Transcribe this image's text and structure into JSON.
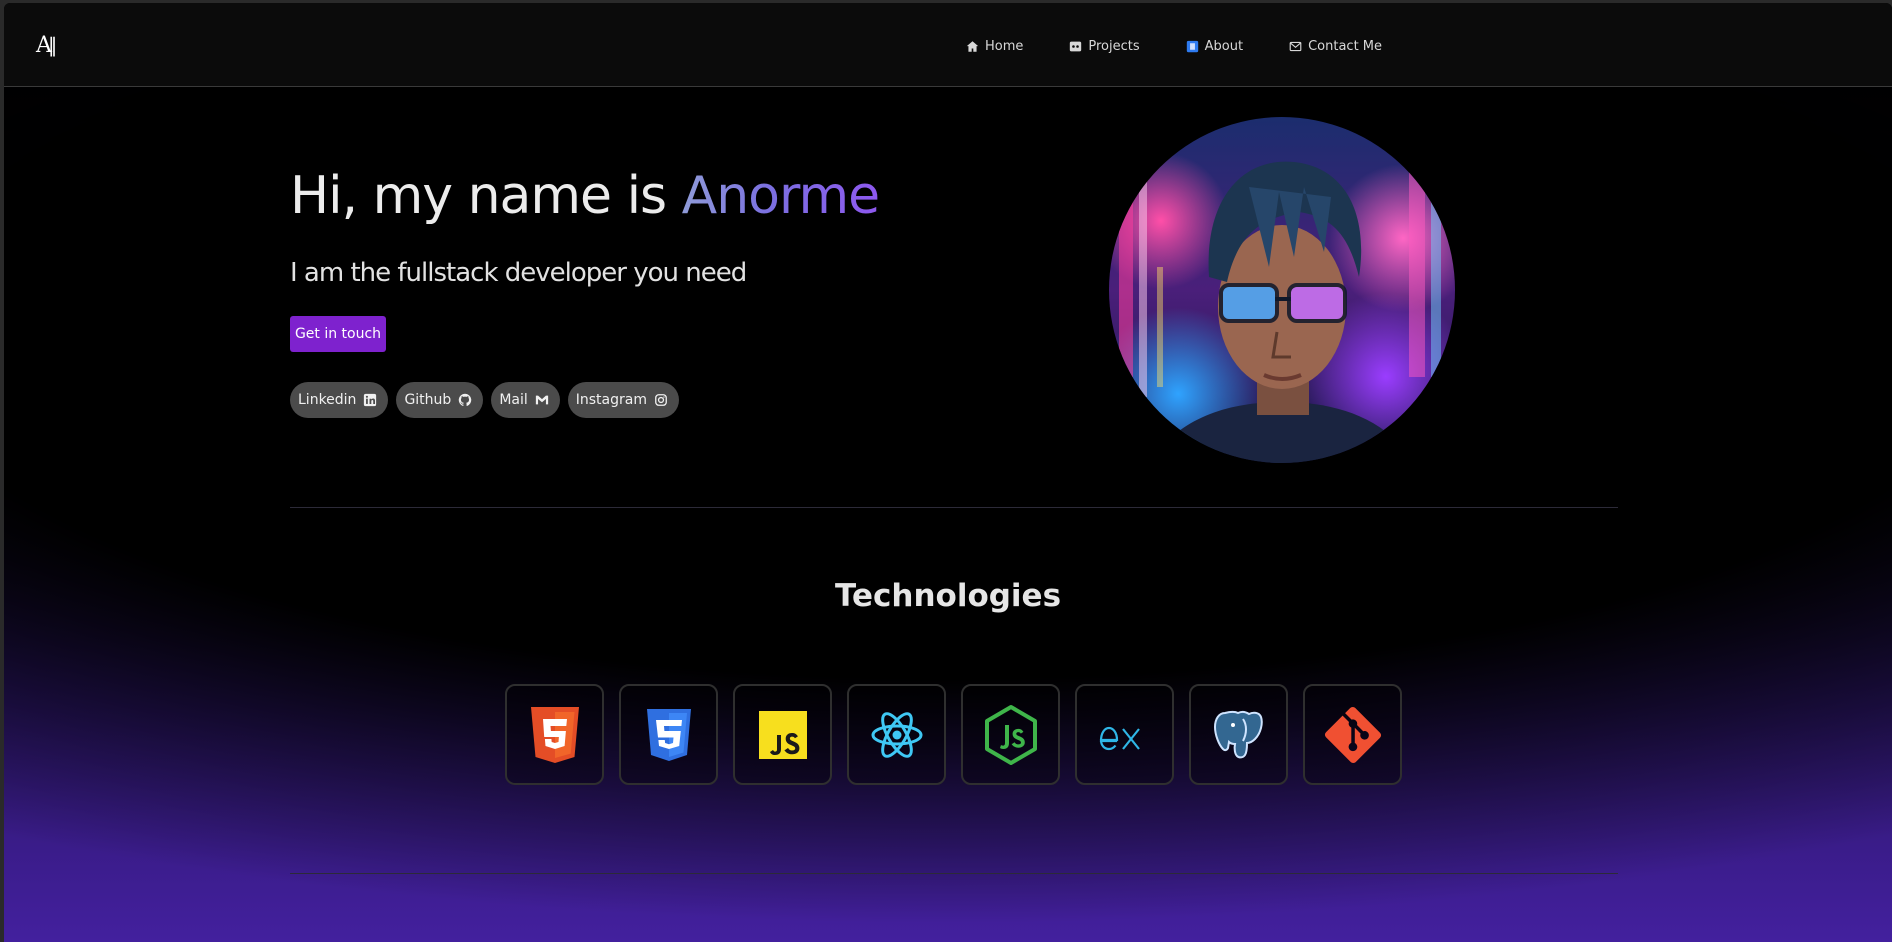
{
  "navbar": {
    "logo": "A",
    "links": [
      {
        "label": "Home",
        "icon": "home-icon"
      },
      {
        "label": "Projects",
        "icon": "projects-icon"
      },
      {
        "label": "About",
        "icon": "about-icon"
      },
      {
        "label": "Contact Me",
        "icon": "mail-icon"
      }
    ]
  },
  "hero": {
    "greeting": "Hi, my name is ",
    "name": "Anorme",
    "subtitle": "I am the fullstack developer you need",
    "cta_label": "Get in touch",
    "socials": [
      {
        "label": "Linkedin",
        "icon": "linkedin-icon"
      },
      {
        "label": "Github",
        "icon": "github-icon"
      },
      {
        "label": "Mail",
        "icon": "gmail-icon"
      },
      {
        "label": "Instagram",
        "icon": "instagram-icon"
      }
    ]
  },
  "technologies": {
    "title": "Technologies",
    "items": [
      {
        "icon": "html5-icon"
      },
      {
        "icon": "css3-icon"
      },
      {
        "icon": "javascript-icon"
      },
      {
        "icon": "react-icon"
      },
      {
        "icon": "nodejs-icon"
      },
      {
        "icon": "express-icon"
      },
      {
        "icon": "postgresql-icon"
      },
      {
        "icon": "git-icon"
      }
    ]
  },
  "colors": {
    "accent": "#7e22ce",
    "background_glow": "#43209e",
    "navbar": "#0b0b0b"
  }
}
